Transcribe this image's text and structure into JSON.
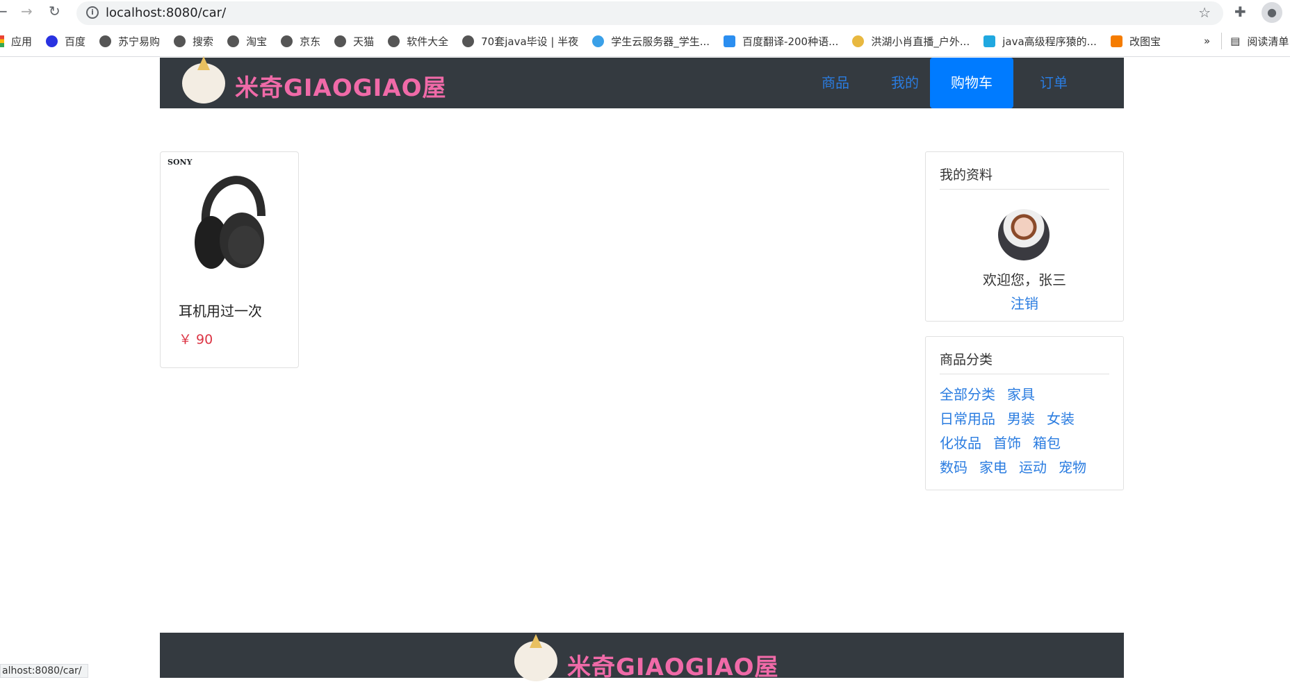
{
  "browser": {
    "url": "localhost:8080/car/",
    "status_url": "alhost:8080/car/",
    "bookmarks": [
      "应用",
      "百度",
      "苏宁易购",
      "搜索",
      "淘宝",
      "京东",
      "天猫",
      "软件大全",
      "70套java毕设 | 半夜",
      "学生云服务器_学生...",
      "百度翻译-200种语...",
      "洪湖小肖直播_户外...",
      "java高级程序猿的...",
      "改图宝"
    ],
    "overflow": "»",
    "reading_list": "阅读清单"
  },
  "header": {
    "logo_text": "米奇GIAOGIAO屋",
    "nav": [
      "商品",
      "我的",
      "购物车",
      "订单"
    ],
    "active": "购物车"
  },
  "cart": {
    "items": [
      {
        "brand": "SONY",
        "title": "耳机用过一次",
        "price": "￥ 90"
      }
    ]
  },
  "profile": {
    "heading": "我的资料",
    "welcome": "欢迎您，张三",
    "logout": "注销"
  },
  "categories": {
    "heading": "商品分类",
    "items": [
      "全部分类",
      "家具",
      "日常用品",
      "男装",
      "女装",
      "化妆品",
      "首饰",
      "箱包",
      "数码",
      "家电",
      "运动",
      "宠物"
    ]
  },
  "footer": {
    "logo_text": "米奇GIAOGIAO屋"
  }
}
